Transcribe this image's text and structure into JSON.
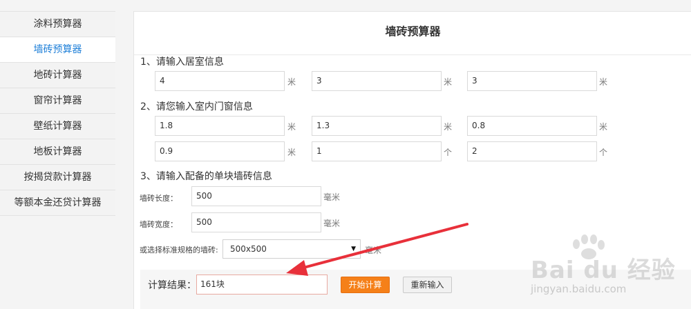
{
  "sidebar": {
    "items": [
      {
        "label": "涂料预算器"
      },
      {
        "label": "墙砖预算器"
      },
      {
        "label": "地砖计算器"
      },
      {
        "label": "窗帘计算器"
      },
      {
        "label": "壁纸计算器"
      },
      {
        "label": "地板计算器"
      },
      {
        "label": "按揭贷款计算器"
      },
      {
        "label": "等额本金还贷计算器"
      }
    ],
    "active_index": 1,
    "active_color": "#1e7fd8"
  },
  "panel": {
    "title": "墙砖预算器",
    "section1": {
      "heading": "1、请输入居室信息",
      "fields": [
        {
          "value": "4",
          "unit": "米"
        },
        {
          "value": "3",
          "unit": "米"
        },
        {
          "value": "3",
          "unit": "米"
        }
      ]
    },
    "section2": {
      "heading": "2、请您输入室内门窗信息",
      "row1": [
        {
          "value": "1.8",
          "unit": "米"
        },
        {
          "value": "1.3",
          "unit": "米"
        },
        {
          "value": "0.8",
          "unit": "米"
        }
      ],
      "row2": [
        {
          "value": "0.9",
          "unit": "米"
        },
        {
          "value": "1",
          "unit": "个"
        },
        {
          "value": "2",
          "unit": "个"
        }
      ]
    },
    "section3": {
      "heading": "3、请输入配备的单块墙砖信息",
      "length_label": "墙砖长度：",
      "length_value": "500",
      "length_unit": "毫米",
      "width_label": "墙砖宽度：",
      "width_value": "500",
      "width_unit": "毫米",
      "select_label": "或选择标准规格的墙砖:",
      "select_value": "500x500",
      "select_unit": "毫米"
    },
    "result": {
      "label": "计算结果：",
      "value": "161块",
      "calc_button": "开始计算",
      "reset_button": "重新输入"
    }
  },
  "colors": {
    "accent_orange": "#f58019",
    "annotation_red": "#e8303a"
  },
  "watermark": {
    "text": "Bai du 经验",
    "url": "jingyan.baidu.com"
  }
}
